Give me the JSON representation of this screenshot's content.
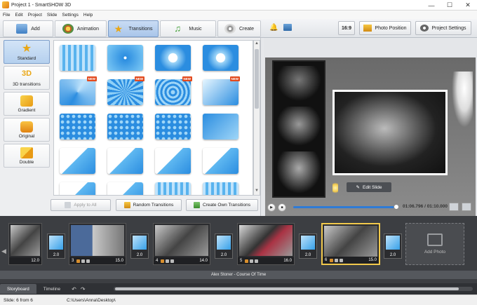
{
  "window": {
    "title": "Project 1 - SmartSHOW 3D",
    "minimize": "—",
    "maximize": "☐",
    "close": "✕"
  },
  "menu": [
    "File",
    "Edit",
    "Project",
    "Slide",
    "Settings",
    "Help"
  ],
  "tabs": [
    {
      "label": "Add",
      "active": false,
      "icon": "add-photo-icon"
    },
    {
      "label": "Animation",
      "active": false,
      "icon": "palette-icon"
    },
    {
      "label": "Transitions",
      "active": true,
      "icon": "star-icon"
    },
    {
      "label": "Music",
      "active": false,
      "icon": "music-note-icon"
    },
    {
      "label": "Create",
      "active": false,
      "icon": "film-reel-icon"
    }
  ],
  "toolbar": {
    "aspect": "16:9",
    "photo_position": "Photo Position",
    "project_settings": "Project Settings"
  },
  "categories": [
    {
      "label": "Standard",
      "active": true
    },
    {
      "label": "3D transitions",
      "active": false
    },
    {
      "label": "Gradient",
      "active": false
    },
    {
      "label": "Original",
      "active": false
    },
    {
      "label": "Double",
      "active": false
    }
  ],
  "transitions_new_badge": "NEW",
  "transitions": [
    {
      "new": false,
      "style": "stripes"
    },
    {
      "new": false,
      "style": "dot"
    },
    {
      "new": false,
      "style": "circle"
    },
    {
      "new": false,
      "style": "circle"
    },
    {
      "new": true,
      "style": "swirl"
    },
    {
      "new": true,
      "style": "radial"
    },
    {
      "new": true,
      "style": "rings"
    },
    {
      "new": true,
      "style": "gradient"
    },
    {
      "new": false,
      "style": "hex"
    },
    {
      "new": false,
      "style": "hex"
    },
    {
      "new": false,
      "style": "hex"
    },
    {
      "new": false,
      "style": "diamond"
    },
    {
      "new": false,
      "style": "diag"
    },
    {
      "new": false,
      "style": "diag"
    },
    {
      "new": false,
      "style": "diag"
    },
    {
      "new": false,
      "style": "diag"
    },
    {
      "new": false,
      "style": "diag"
    },
    {
      "new": false,
      "style": "diag"
    },
    {
      "new": false,
      "style": "stripes"
    },
    {
      "new": false,
      "style": "stripes"
    }
  ],
  "actions": {
    "apply_all": "Apply to All",
    "random": "Random Transitions",
    "create_own": "Create Own Transitions"
  },
  "preview": {
    "edit_slide": "Edit Slide",
    "time": "01:06.796 / 01:10.000",
    "progress": 0.954
  },
  "storyboard": {
    "slides": [
      {
        "num": "",
        "dur": "12.0"
      },
      {
        "num": "3",
        "dur": "15.0"
      },
      {
        "num": "4",
        "dur": "14.0"
      },
      {
        "num": "5",
        "dur": "16.0"
      },
      {
        "num": "6",
        "dur": "15.0",
        "selected": true
      }
    ],
    "transitions": [
      "2.0",
      "2.0",
      "2.0",
      "2.0",
      "2.0",
      "2.0"
    ],
    "add_photo": "Add Photo",
    "audio": "Alex Stoner - Course Of Time"
  },
  "bottom_tabs": [
    "Storyboard",
    "Timeline"
  ],
  "status": {
    "slide": "Slide: 6 from 6",
    "path": "C:\\Users\\Anna\\Desktop\\"
  },
  "colors": {
    "accent": "#2e7bd6",
    "selected": "#f2c94c",
    "new_badge": "#e24a1e"
  }
}
